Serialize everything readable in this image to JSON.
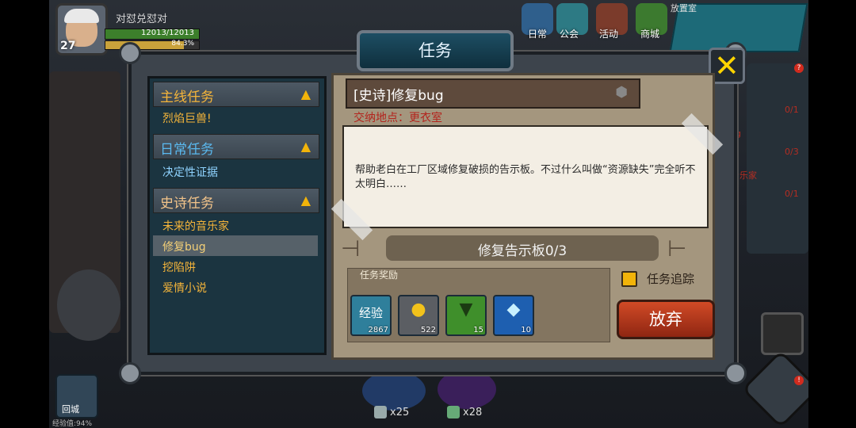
{
  "hud": {
    "player_name": "对怼兑怼对",
    "hp": "12013/12013",
    "xp_percent": "84.3%",
    "level": "27",
    "top_menu": [
      {
        "label": "日常",
        "icon": "calendar-icon"
      },
      {
        "label": "公会",
        "icon": "fist-icon"
      },
      {
        "label": "活动",
        "icon": "gift-icon"
      },
      {
        "label": "商城",
        "icon": "cart-icon"
      }
    ],
    "minimap_label": "放置室",
    "back_city": "回城",
    "exp_small": "经验值:94%",
    "currency_1": "x25",
    "currency_2": "x28"
  },
  "panel": {
    "title": "任务",
    "categories": [
      {
        "title": "主线任务",
        "color": "#f5b53a",
        "items": [
          "烈焰巨兽!"
        ]
      },
      {
        "title": "日常任务",
        "color": "#5ab9ef",
        "items": [
          "决定性证据"
        ]
      },
      {
        "title": "史诗任务",
        "color": "#f3c48a",
        "items": [
          "未来的音乐家",
          "修复bug",
          "挖陷阱",
          "爱情小说"
        ]
      }
    ],
    "selected_item": "修复bug"
  },
  "detail": {
    "quest_title": "[史诗]修复bug",
    "deliver_location": "交纳地点：更衣室",
    "description": "帮助老白在工厂区域修复破损的告示板。不过什么叫做“资源缺失”完全听不太明白……",
    "progress_label": "修复告示板",
    "progress_value": "0/3",
    "reward_title": "任务奖励",
    "rewards": [
      {
        "icon": "exp-book-icon",
        "label": "经验",
        "count": "2867",
        "color": "#2f7f9b"
      },
      {
        "icon": "gold-coins-icon",
        "label": "",
        "count": "522",
        "color": "#5b5e63"
      },
      {
        "icon": "green-part-icon",
        "label": "",
        "count": "15",
        "color": "#3f8f2b"
      },
      {
        "icon": "crystal-icon",
        "label": "",
        "count": "10",
        "color": "#1e5fb0"
      }
    ],
    "track_label": "任务追踪",
    "abandon_label": "放弃"
  },
  "side_counts": [
    "0/1",
    "0/3",
    "0/1"
  ],
  "side_labels": [
    "g",
    "音乐家"
  ]
}
